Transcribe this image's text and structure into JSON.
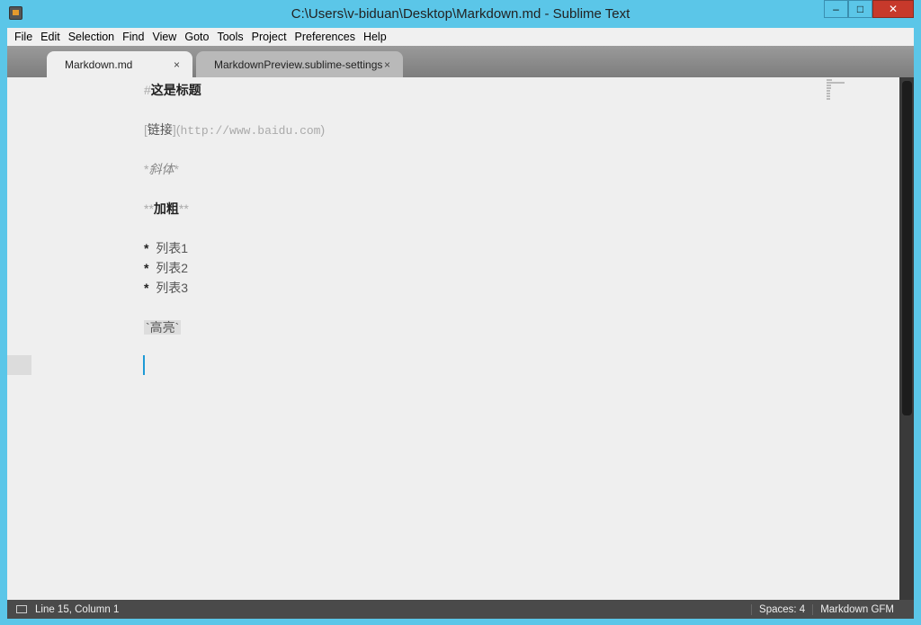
{
  "window": {
    "title": "C:\\Users\\v-biduan\\Desktop\\Markdown.md - Sublime Text",
    "minimize": "–",
    "maximize": "□",
    "close": "✕"
  },
  "menu": [
    "File",
    "Edit",
    "Selection",
    "Find",
    "View",
    "Goto",
    "Tools",
    "Project",
    "Preferences",
    "Help"
  ],
  "tabs": [
    {
      "label": "Markdown.md",
      "close": "×"
    },
    {
      "label": "MarkdownPreview.sublime-settings",
      "close": "×"
    }
  ],
  "editor": {
    "heading": {
      "mark": "#",
      "text": "这是标题"
    },
    "link": {
      "open": "[",
      "text": "链接",
      "mid": "](",
      "url": "http://www.baidu.com",
      "close": ")"
    },
    "italic": {
      "mark": "*",
      "text": "斜体"
    },
    "bold": {
      "mark": "**",
      "text": "加粗"
    },
    "list": [
      {
        "bullet": "*",
        "text": "列表1"
      },
      {
        "bullet": "*",
        "text": "列表2"
      },
      {
        "bullet": "*",
        "text": "列表3"
      }
    ],
    "code": {
      "mark": "`",
      "text": "高亮"
    }
  },
  "status": {
    "position": "Line 15, Column 1",
    "spaces": "Spaces: 4",
    "syntax": "Markdown GFM"
  }
}
